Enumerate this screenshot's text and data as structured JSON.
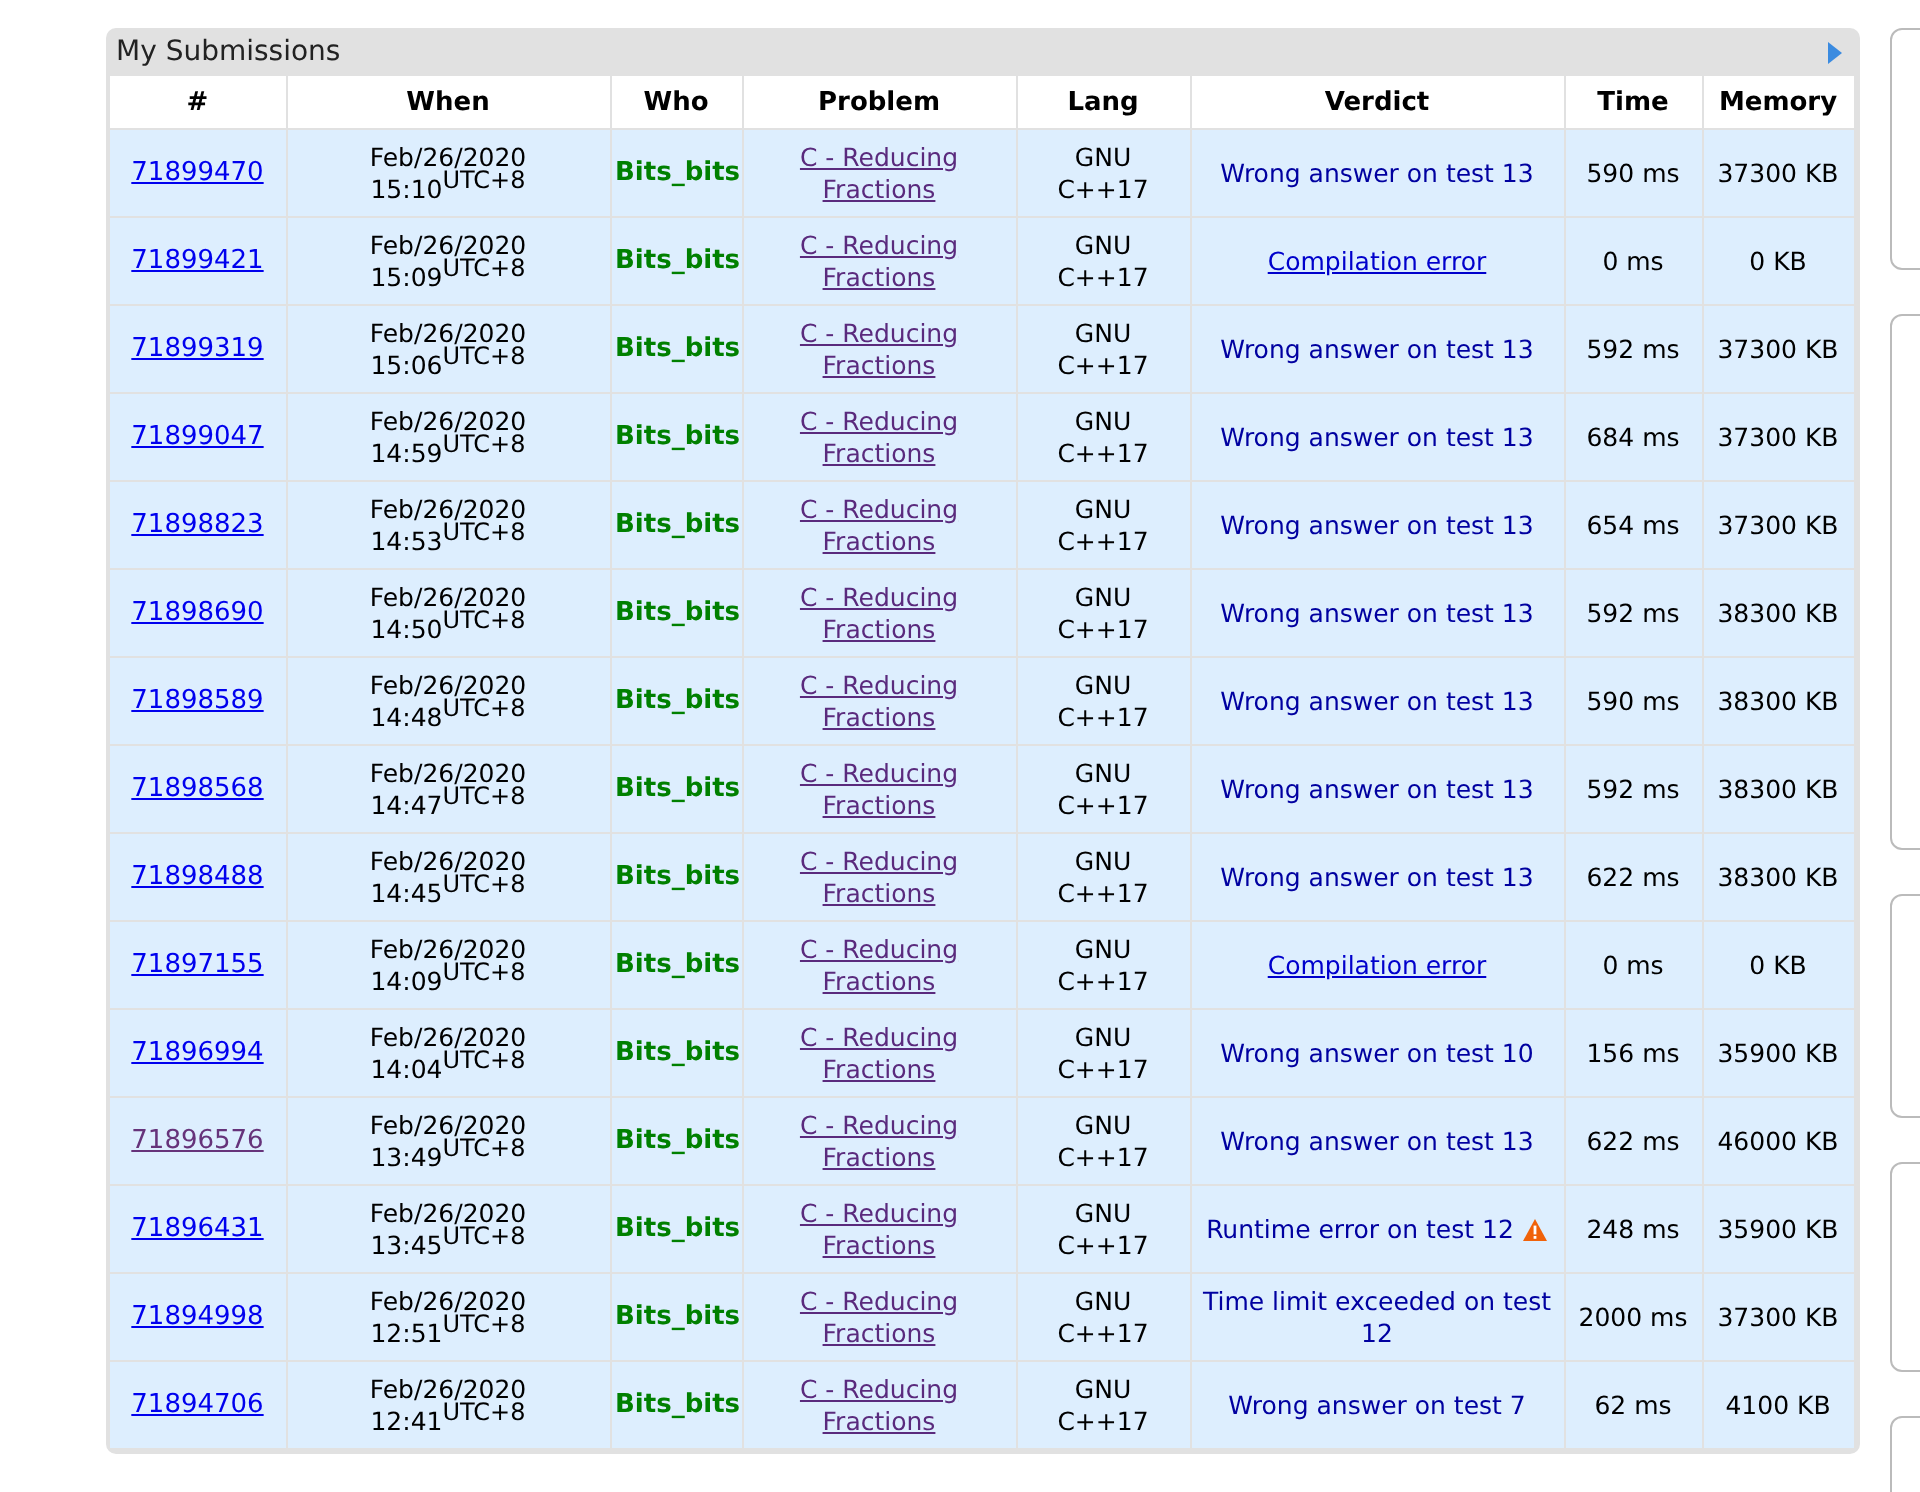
{
  "panel": {
    "title": "My Submissions"
  },
  "table": {
    "columns": [
      "#",
      "When",
      "Who",
      "Problem",
      "Lang",
      "Verdict",
      "Time",
      "Memory"
    ],
    "rows": [
      {
        "id": "71899470",
        "visited": false,
        "date": "Feb/26/2020",
        "time": "15:10",
        "tz": "UTC+8",
        "who": "Bits_bits",
        "problem": "C - Reducing Fractions",
        "lang": "GNU C++17",
        "verdict": {
          "text": "Wrong answer on test 13",
          "kind": "text",
          "warning": false
        },
        "run_time": "590 ms",
        "memory": "37300 KB"
      },
      {
        "id": "71899421",
        "visited": false,
        "date": "Feb/26/2020",
        "time": "15:09",
        "tz": "UTC+8",
        "who": "Bits_bits",
        "problem": "C - Reducing Fractions",
        "lang": "GNU C++17",
        "verdict": {
          "text": "Compilation error",
          "kind": "link",
          "warning": false
        },
        "run_time": "0 ms",
        "memory": "0 KB"
      },
      {
        "id": "71899319",
        "visited": false,
        "date": "Feb/26/2020",
        "time": "15:06",
        "tz": "UTC+8",
        "who": "Bits_bits",
        "problem": "C - Reducing Fractions",
        "lang": "GNU C++17",
        "verdict": {
          "text": "Wrong answer on test 13",
          "kind": "text",
          "warning": false
        },
        "run_time": "592 ms",
        "memory": "37300 KB"
      },
      {
        "id": "71899047",
        "visited": false,
        "date": "Feb/26/2020",
        "time": "14:59",
        "tz": "UTC+8",
        "who": "Bits_bits",
        "problem": "C - Reducing Fractions",
        "lang": "GNU C++17",
        "verdict": {
          "text": "Wrong answer on test 13",
          "kind": "text",
          "warning": false
        },
        "run_time": "684 ms",
        "memory": "37300 KB"
      },
      {
        "id": "71898823",
        "visited": false,
        "date": "Feb/26/2020",
        "time": "14:53",
        "tz": "UTC+8",
        "who": "Bits_bits",
        "problem": "C - Reducing Fractions",
        "lang": "GNU C++17",
        "verdict": {
          "text": "Wrong answer on test 13",
          "kind": "text",
          "warning": false
        },
        "run_time": "654 ms",
        "memory": "37300 KB"
      },
      {
        "id": "71898690",
        "visited": false,
        "date": "Feb/26/2020",
        "time": "14:50",
        "tz": "UTC+8",
        "who": "Bits_bits",
        "problem": "C - Reducing Fractions",
        "lang": "GNU C++17",
        "verdict": {
          "text": "Wrong answer on test 13",
          "kind": "text",
          "warning": false
        },
        "run_time": "592 ms",
        "memory": "38300 KB"
      },
      {
        "id": "71898589",
        "visited": false,
        "date": "Feb/26/2020",
        "time": "14:48",
        "tz": "UTC+8",
        "who": "Bits_bits",
        "problem": "C - Reducing Fractions",
        "lang": "GNU C++17",
        "verdict": {
          "text": "Wrong answer on test 13",
          "kind": "text",
          "warning": false
        },
        "run_time": "590 ms",
        "memory": "38300 KB"
      },
      {
        "id": "71898568",
        "visited": false,
        "date": "Feb/26/2020",
        "time": "14:47",
        "tz": "UTC+8",
        "who": "Bits_bits",
        "problem": "C - Reducing Fractions",
        "lang": "GNU C++17",
        "verdict": {
          "text": "Wrong answer on test 13",
          "kind": "text",
          "warning": false
        },
        "run_time": "592 ms",
        "memory": "38300 KB"
      },
      {
        "id": "71898488",
        "visited": false,
        "date": "Feb/26/2020",
        "time": "14:45",
        "tz": "UTC+8",
        "who": "Bits_bits",
        "problem": "C - Reducing Fractions",
        "lang": "GNU C++17",
        "verdict": {
          "text": "Wrong answer on test 13",
          "kind": "text",
          "warning": false
        },
        "run_time": "622 ms",
        "memory": "38300 KB"
      },
      {
        "id": "71897155",
        "visited": false,
        "date": "Feb/26/2020",
        "time": "14:09",
        "tz": "UTC+8",
        "who": "Bits_bits",
        "problem": "C - Reducing Fractions",
        "lang": "GNU C++17",
        "verdict": {
          "text": "Compilation error",
          "kind": "link",
          "warning": false
        },
        "run_time": "0 ms",
        "memory": "0 KB"
      },
      {
        "id": "71896994",
        "visited": false,
        "date": "Feb/26/2020",
        "time": "14:04",
        "tz": "UTC+8",
        "who": "Bits_bits",
        "problem": "C - Reducing Fractions",
        "lang": "GNU C++17",
        "verdict": {
          "text": "Wrong answer on test 10",
          "kind": "text",
          "warning": false
        },
        "run_time": "156 ms",
        "memory": "35900 KB"
      },
      {
        "id": "71896576",
        "visited": true,
        "date": "Feb/26/2020",
        "time": "13:49",
        "tz": "UTC+8",
        "who": "Bits_bits",
        "problem": "C - Reducing Fractions",
        "lang": "GNU C++17",
        "verdict": {
          "text": "Wrong answer on test 13",
          "kind": "text",
          "warning": false
        },
        "run_time": "622 ms",
        "memory": "46000 KB"
      },
      {
        "id": "71896431",
        "visited": false,
        "date": "Feb/26/2020",
        "time": "13:45",
        "tz": "UTC+8",
        "who": "Bits_bits",
        "problem": "C - Reducing Fractions",
        "lang": "GNU C++17",
        "verdict": {
          "text": "Runtime error on test 12",
          "kind": "text",
          "warning": true
        },
        "run_time": "248 ms",
        "memory": "35900 KB"
      },
      {
        "id": "71894998",
        "visited": false,
        "date": "Feb/26/2020",
        "time": "12:51",
        "tz": "UTC+8",
        "who": "Bits_bits",
        "problem": "C - Reducing Fractions",
        "lang": "GNU C++17",
        "verdict": {
          "text": "Time limit exceeded on test 12",
          "kind": "text",
          "warning": false
        },
        "run_time": "2000 ms",
        "memory": "37300 KB"
      },
      {
        "id": "71894706",
        "visited": false,
        "date": "Feb/26/2020",
        "time": "12:41",
        "tz": "UTC+8",
        "who": "Bits_bits",
        "problem": "C - Reducing Fractions",
        "lang": "GNU C++17",
        "verdict": {
          "text": "Wrong answer on test 7",
          "kind": "text",
          "warning": false
        },
        "run_time": "62 ms",
        "memory": "4100 KB"
      }
    ]
  }
}
